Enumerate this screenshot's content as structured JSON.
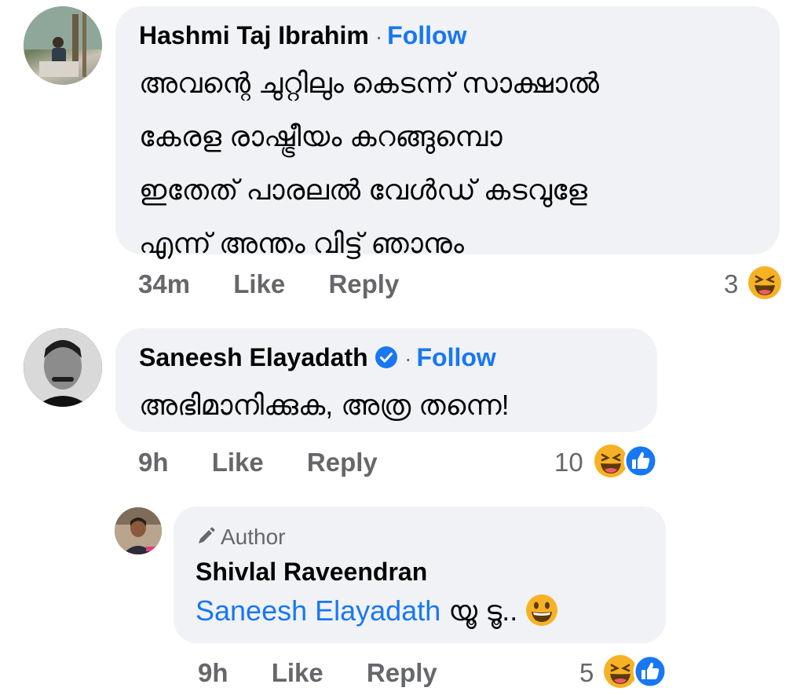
{
  "comments": [
    {
      "author": "Hashmi Taj Ibrahim",
      "follow_label": "Follow",
      "text_lines": [
        "അവന്റെ ചുറ്റിലും കെടന്ന് സാക്ഷാൽ",
        "കേരള രാഷ്ട്രീയം കറങ്ങുമ്പൊ",
        "ഇതേത് പാരലൽ വേൾഡ് കടവുളേ",
        "എന്ന് അന്തം വിട്ട് ഞാനും"
      ],
      "time": "34m",
      "like_label": "Like",
      "reply_label": "Reply",
      "reaction_count": "3",
      "reactions": [
        "laughing-emoji"
      ]
    },
    {
      "author": "Saneesh Elayadath",
      "verified": true,
      "follow_label": "Follow",
      "text": "അഭിമാനിക്കുക, അത്ര തന്നെ!",
      "time": "9h",
      "like_label": "Like",
      "reply_label": "Reply",
      "reaction_count": "10",
      "reactions": [
        "laughing-emoji",
        "like-icon"
      ]
    },
    {
      "badge": "Author",
      "author": "Shivlal Raveendran",
      "mention": "Saneesh Elayadath",
      "text_suffix": " യൂ ടൂ..",
      "time": "9h",
      "like_label": "Like",
      "reply_label": "Reply",
      "reaction_count": "5",
      "reactions": [
        "laughing-emoji",
        "like-icon"
      ]
    }
  ],
  "colors": {
    "bubble": "#f0f2f5",
    "link": "#1877f2",
    "muted": "#65676b",
    "emoji": "#f7b125"
  }
}
